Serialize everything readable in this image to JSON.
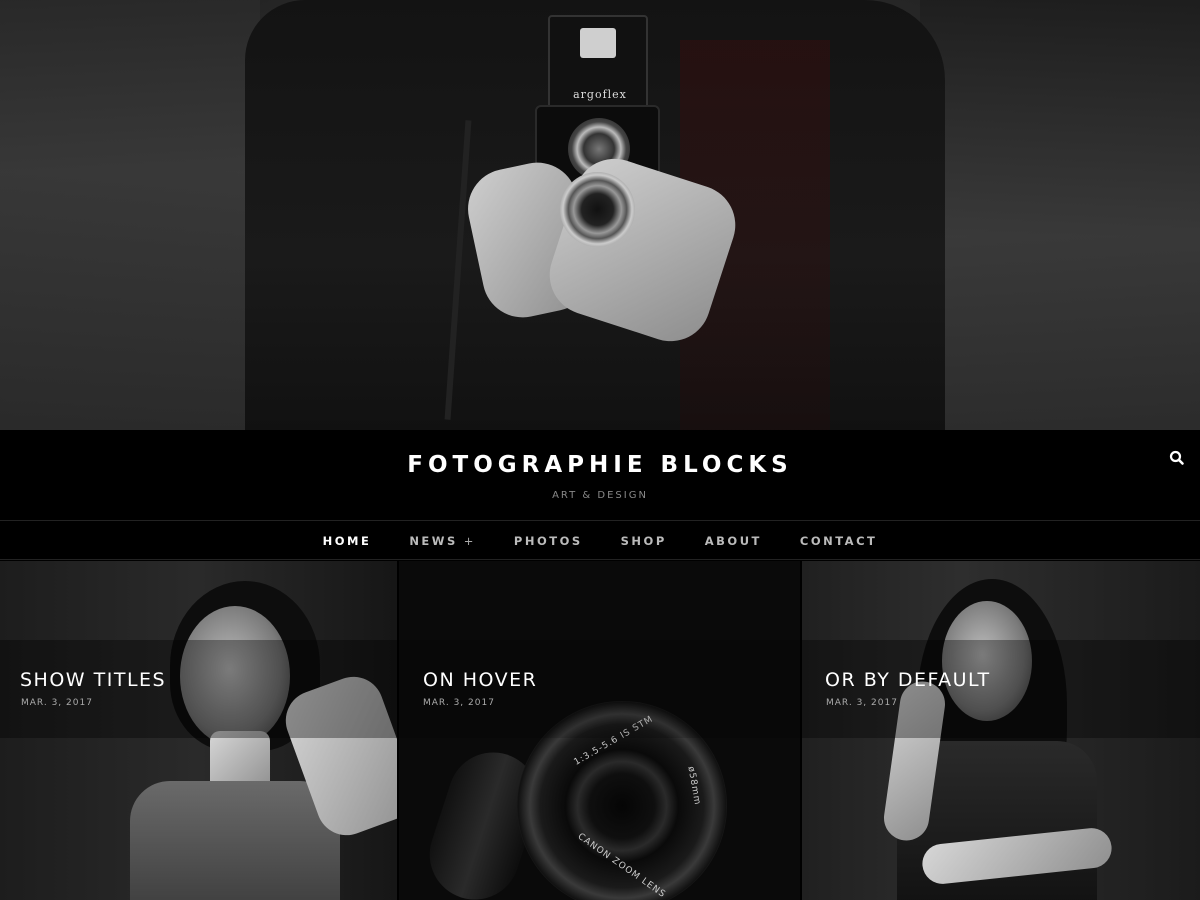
{
  "site": {
    "title": "FOTOGRAPHIE BLOCKS",
    "tagline": "ART & DESIGN",
    "hero_camera_brand": "argoflex"
  },
  "nav": {
    "items": [
      {
        "label": "HOME",
        "active": true
      },
      {
        "label": "NEWS",
        "has_submenu": true,
        "submenu_indicator": "+"
      },
      {
        "label": "PHOTOS"
      },
      {
        "label": "SHOP"
      },
      {
        "label": "ABOUT"
      },
      {
        "label": "CONTACT"
      }
    ]
  },
  "icons": {
    "search": "search-icon"
  },
  "posts": [
    {
      "title": "SHOW TITLES",
      "date": "MAR. 3, 2017"
    },
    {
      "title": "ON HOVER",
      "date": "MAR. 3, 2017"
    },
    {
      "title": "OR BY DEFAULT",
      "date": "MAR. 3, 2017"
    }
  ],
  "colors": {
    "background": "#000000",
    "text": "#ffffff",
    "muted": "#888888"
  }
}
